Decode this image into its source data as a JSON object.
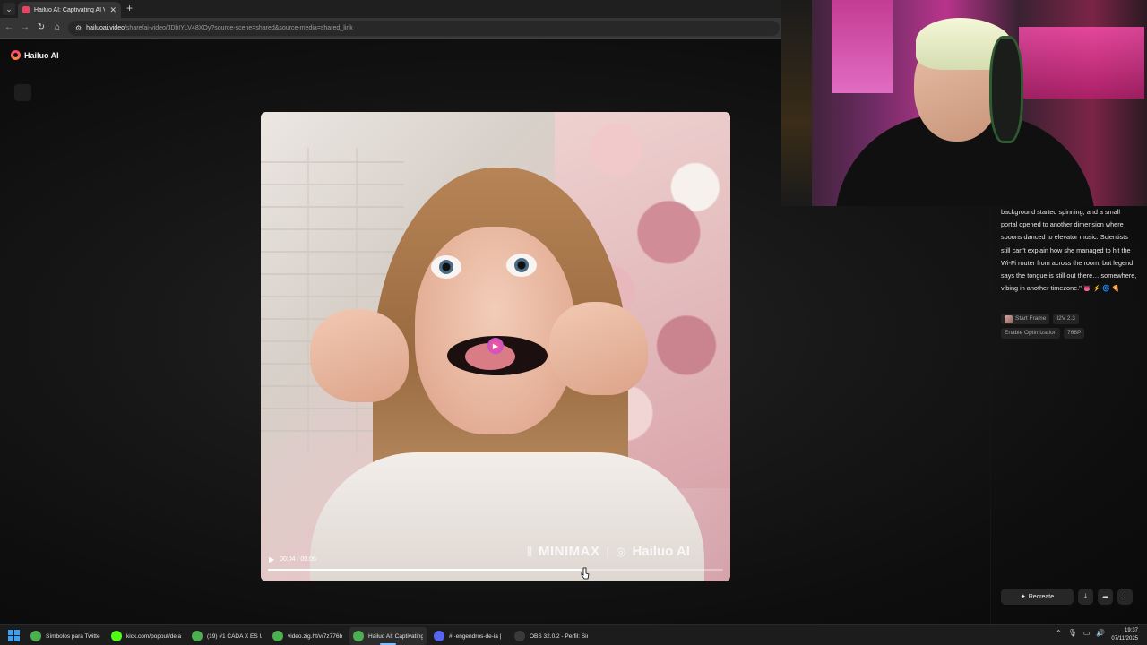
{
  "browser": {
    "tab_title": "Hailuo AI: Captivating AI Video",
    "url_domain": "hailuoai.video",
    "url_path": "/share/ai-video/JDbIYLV48XOy?source-scene=shared&source-media=shared_link",
    "icons": [
      "chevron-down-icon",
      "close-icon",
      "plus-icon",
      "back-icon",
      "forward-icon",
      "reload-icon",
      "home-icon",
      "site-info-icon"
    ]
  },
  "brand": {
    "name": "Hailuo AI",
    "accent": "#ff3d6e"
  },
  "video": {
    "time": "00:04 / 00:06",
    "progress": 0.69,
    "watermark_left": "MINIMAX",
    "watermark_separator": "|",
    "watermark_right": "Hailuo AI"
  },
  "panel": {
    "description": "background started spinning, and a small portal opened to another dimension where spoons danced to elevator music. Scientists still can't explain how she managed to hit the Wi-Fi router from across the room, but legend says the tongue is still out there… somewhere, vibing in another timezone.\"",
    "emojis": "👅 ⚡ 🌀 🍕",
    "chips_row1": [
      "Start Frame",
      "I2V 2.3"
    ],
    "chips_row2": [
      "Enable Optimization",
      "768P"
    ],
    "recreate_label": "Recreate",
    "action_icons": [
      "download-icon",
      "share-icon",
      "more-icon"
    ]
  },
  "taskbar": {
    "items": [
      {
        "label": "Símbolos para Twitter: s",
        "color": "#4caf50"
      },
      {
        "label": "kick.com/popout/deiak",
        "color": "#53fc18"
      },
      {
        "label": "(19) #1 CADA X ES UNA I",
        "color": "#4caf50"
      },
      {
        "label": "video.zig.ht/v/7z776bdv",
        "color": "#4caf50"
      },
      {
        "label": "Hailuo AI: Captivating A",
        "color": "#4caf50"
      },
      {
        "label": "# ·engendros-de-ia |",
        "color": "#5865f2"
      },
      {
        "label": "OBS 32.0.2 - Perfil: Sin T",
        "color": "#3a3a3a"
      }
    ],
    "time": "19:37",
    "date": "07/11/2025"
  }
}
